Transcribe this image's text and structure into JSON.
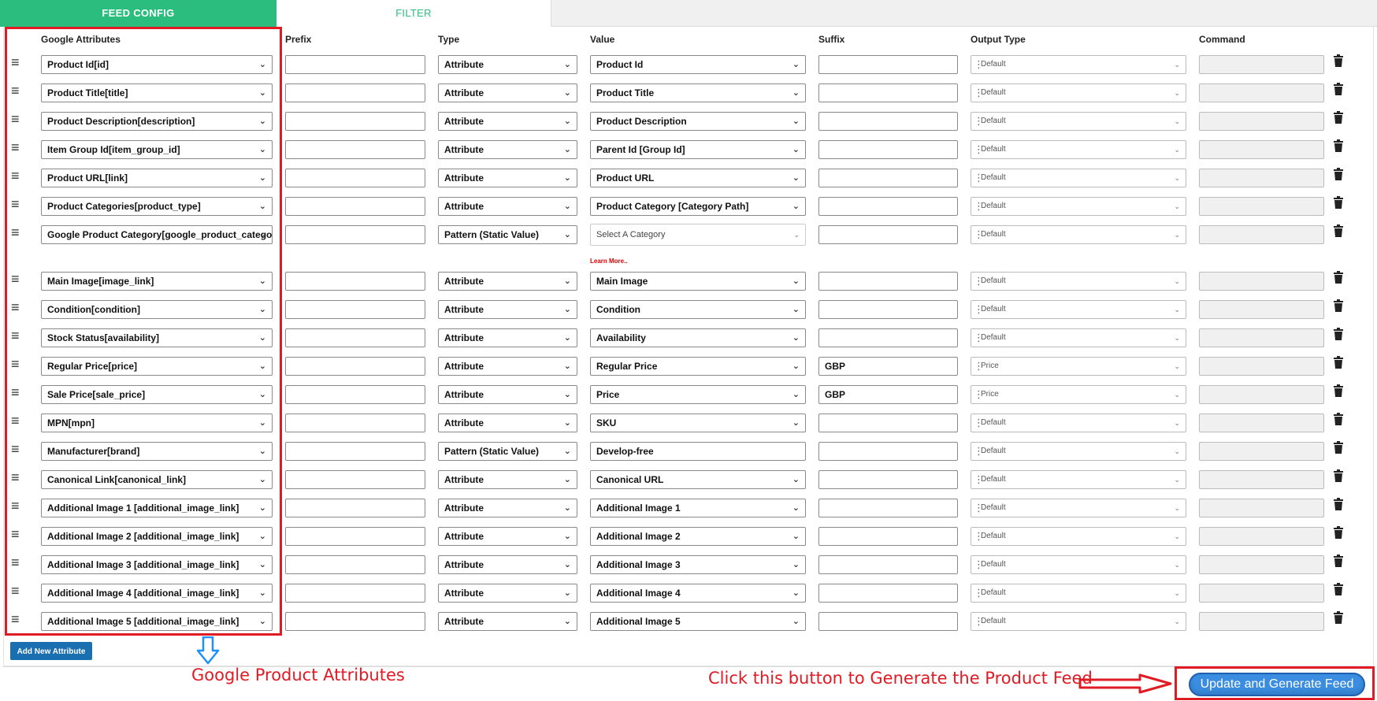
{
  "tabs": {
    "feed_config": "FEED CONFIG",
    "filter": "FILTER"
  },
  "columns": {
    "google_attributes": "Google Attributes",
    "prefix": "Prefix",
    "type": "Type",
    "value": "Value",
    "suffix": "Suffix",
    "output_type": "Output Type",
    "command": "Command"
  },
  "rows": [
    {
      "attr": "Product Id[id]",
      "prefix": "",
      "type": "Attribute",
      "value": "Product Id",
      "suffix": "",
      "output": "Default",
      "command": ""
    },
    {
      "attr": "Product Title[title]",
      "prefix": "",
      "type": "Attribute",
      "value": "Product Title",
      "suffix": "",
      "output": "Default",
      "command": ""
    },
    {
      "attr": "Product Description[description]",
      "prefix": "",
      "type": "Attribute",
      "value": "Product Description",
      "suffix": "",
      "output": "Default",
      "command": ""
    },
    {
      "attr": "Item Group Id[item_group_id]",
      "prefix": "",
      "type": "Attribute",
      "value": "Parent Id [Group Id]",
      "suffix": "",
      "output": "Default",
      "command": ""
    },
    {
      "attr": "Product URL[link]",
      "prefix": "",
      "type": "Attribute",
      "value": "Product URL",
      "suffix": "",
      "output": "Default",
      "command": ""
    },
    {
      "attr": "Product Categories[product_type]",
      "prefix": "",
      "type": "Attribute",
      "value": "Product Category [Category Path]",
      "suffix": "",
      "output": "Default",
      "command": ""
    },
    {
      "attr": "Google Product Category[google_product_category]",
      "prefix": "",
      "type": "Pattern (Static Value)",
      "value": "Select A Category",
      "value_kind": "category_select",
      "suffix": "",
      "output": "Default",
      "command": ""
    },
    {
      "attr": "Main Image[image_link]",
      "prefix": "",
      "type": "Attribute",
      "value": "Main Image",
      "suffix": "",
      "output": "Default",
      "command": ""
    },
    {
      "attr": "Condition[condition]",
      "prefix": "",
      "type": "Attribute",
      "value": "Condition",
      "suffix": "",
      "output": "Default",
      "command": ""
    },
    {
      "attr": "Stock Status[availability]",
      "prefix": "",
      "type": "Attribute",
      "value": "Availability",
      "suffix": "",
      "output": "Default",
      "command": ""
    },
    {
      "attr": "Regular Price[price]",
      "prefix": "",
      "type": "Attribute",
      "value": "Regular Price",
      "suffix": "GBP",
      "output": "Price",
      "command": ""
    },
    {
      "attr": "Sale Price[sale_price]",
      "prefix": "",
      "type": "Attribute",
      "value": "Price",
      "suffix": "GBP",
      "output": "Price",
      "command": ""
    },
    {
      "attr": "MPN[mpn]",
      "prefix": "",
      "type": "Attribute",
      "value": "SKU",
      "suffix": "",
      "output": "Default",
      "command": ""
    },
    {
      "attr": "Manufacturer[brand]",
      "prefix": "",
      "type": "Pattern (Static Value)",
      "value": "Develop-free",
      "value_kind": "text",
      "suffix": "",
      "output": "Default",
      "command": ""
    },
    {
      "attr": "Canonical Link[canonical_link]",
      "prefix": "",
      "type": "Attribute",
      "value": "Canonical URL",
      "suffix": "",
      "output": "Default",
      "command": ""
    },
    {
      "attr": "Additional Image 1 [additional_image_link]",
      "prefix": "",
      "type": "Attribute",
      "value": "Additional Image 1",
      "suffix": "",
      "output": "Default",
      "command": ""
    },
    {
      "attr": "Additional Image 2 [additional_image_link]",
      "prefix": "",
      "type": "Attribute",
      "value": "Additional Image 2",
      "suffix": "",
      "output": "Default",
      "command": ""
    },
    {
      "attr": "Additional Image 3 [additional_image_link]",
      "prefix": "",
      "type": "Attribute",
      "value": "Additional Image 3",
      "suffix": "",
      "output": "Default",
      "command": ""
    },
    {
      "attr": "Additional Image 4 [additional_image_link]",
      "prefix": "",
      "type": "Attribute",
      "value": "Additional Image 4",
      "suffix": "",
      "output": "Default",
      "command": ""
    },
    {
      "attr": "Additional Image 5 [additional_image_link]",
      "prefix": "",
      "type": "Attribute",
      "value": "Additional Image 5",
      "suffix": "",
      "output": "Default",
      "command": ""
    }
  ],
  "learn_more": "Learn More..",
  "add_button": "Add New Attribute",
  "annotations": {
    "attributes_note": "Google Product Attributes",
    "generate_note": "Click this button to Generate the Product Feed"
  },
  "generate_button": "Update and Generate Feed",
  "icons": {
    "drag": "drag-handle-icon",
    "delete": "trash-icon",
    "dropdown": "chevron-down-icon",
    "arrow_down": "arrow-down-outline-icon",
    "arrow_right": "arrow-right-outline-icon"
  },
  "colors": {
    "tab_active": "#2bbd7e",
    "annotation_red": "#e01b24",
    "button_blue": "#1a6fb0",
    "generate_blue": "#3a8de0"
  }
}
